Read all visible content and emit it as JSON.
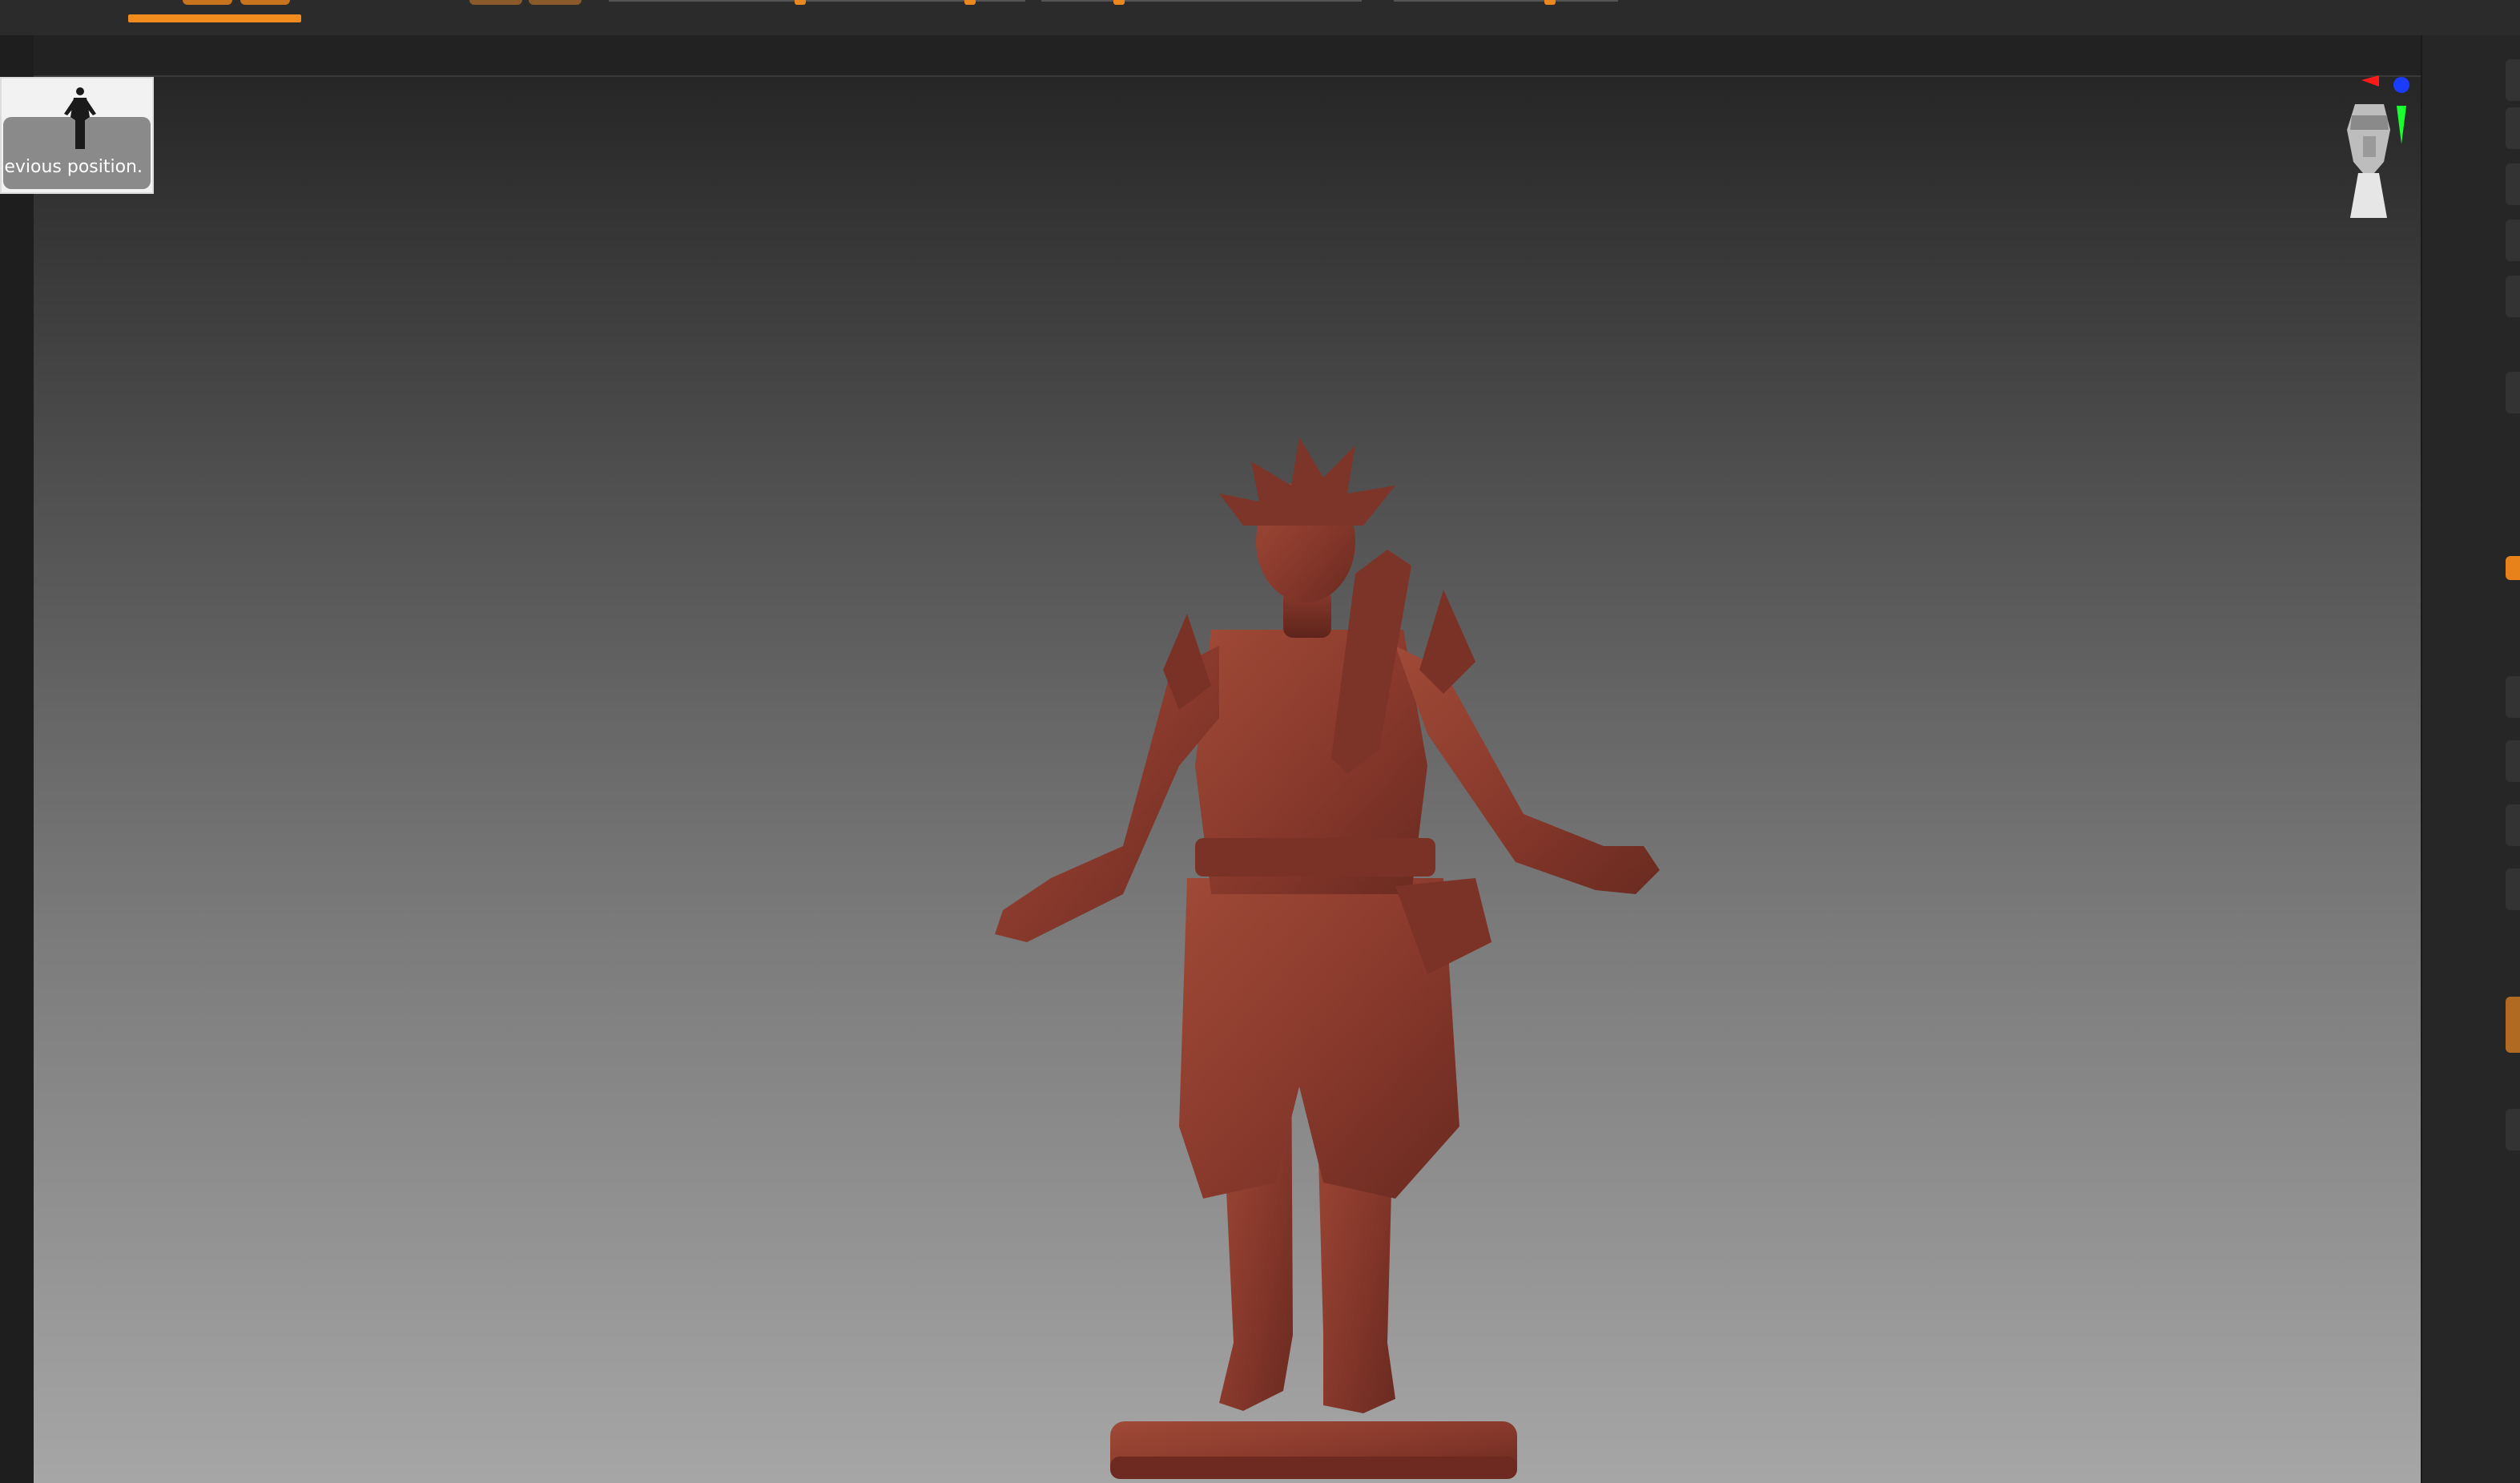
{
  "app": {
    "accent_color": "#f08c1e",
    "model_color": "#8a3a2c"
  },
  "tooltip": {
    "text": "evious position."
  },
  "gizmo": {
    "x_axis_color": "#ff1a1a",
    "y_axis_color": "#1aff2e",
    "z_axis_color": "#1a3cff"
  },
  "icons": {
    "tooltip_thumb": "figure-icon",
    "gizmo": "head-navigation-icon"
  }
}
